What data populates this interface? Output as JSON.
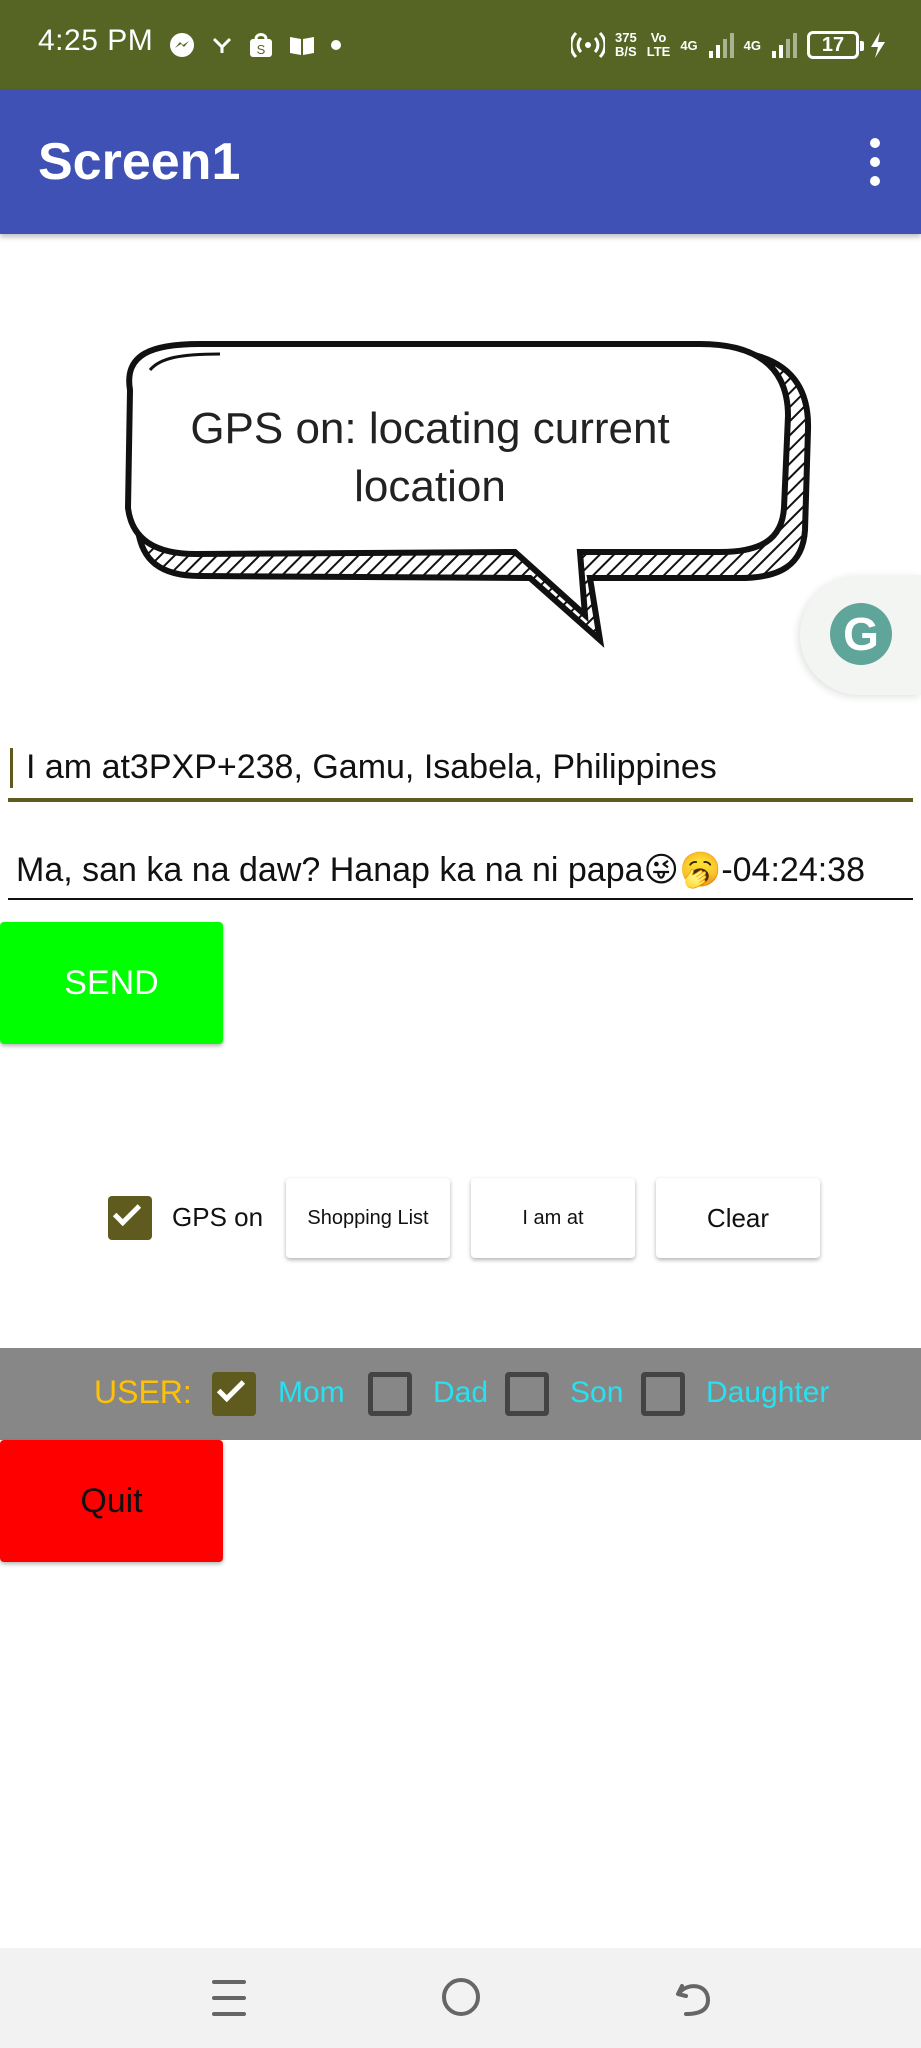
{
  "status_bar": {
    "time": "4:25 PM",
    "left_icons": [
      "messenger-icon",
      "network-icon",
      "shop-icon",
      "book-icon",
      "dot-icon"
    ],
    "net_speed_value": "375",
    "net_speed_unit": "B/S",
    "volte_top": "Vo",
    "volte_bottom": "LTE",
    "signal1_label": "4G",
    "signal2_label": "4G",
    "battery": "17",
    "color": "#566524"
  },
  "app_bar": {
    "title": "Screen1",
    "color": "#3f51b5"
  },
  "bubble": {
    "text": "GPS on: locating current location"
  },
  "grammarly": {
    "letter": "G"
  },
  "location_field": {
    "value": "I am at3PXP+238, Gamu, Isabela, Philippines"
  },
  "message_field": {
    "value": "Ma, san ka na daw? Hanap ka na ni papa😜🥱-04:24:38"
  },
  "buttons": {
    "send": "SEND",
    "shopping_list": "Shopping List",
    "i_am_at": "I am at",
    "clear": "Clear",
    "quit": "Quit"
  },
  "gps": {
    "label": "GPS on",
    "checked": true
  },
  "user": {
    "label": "USER:",
    "options": [
      {
        "label": "Mom",
        "checked": true
      },
      {
        "label": "Dad",
        "checked": false
      },
      {
        "label": "Son",
        "checked": false
      },
      {
        "label": "Daughter",
        "checked": false
      }
    ]
  },
  "colors": {
    "send": "#00ff00",
    "quit": "#ff0000",
    "user_bar": "#878787",
    "user_label": "#ffc107",
    "user_option": "#28e0ef",
    "accent": "#5f5a1e"
  },
  "nav_bar": {
    "icons": [
      "recent-apps-icon",
      "home-icon",
      "back-icon"
    ]
  }
}
